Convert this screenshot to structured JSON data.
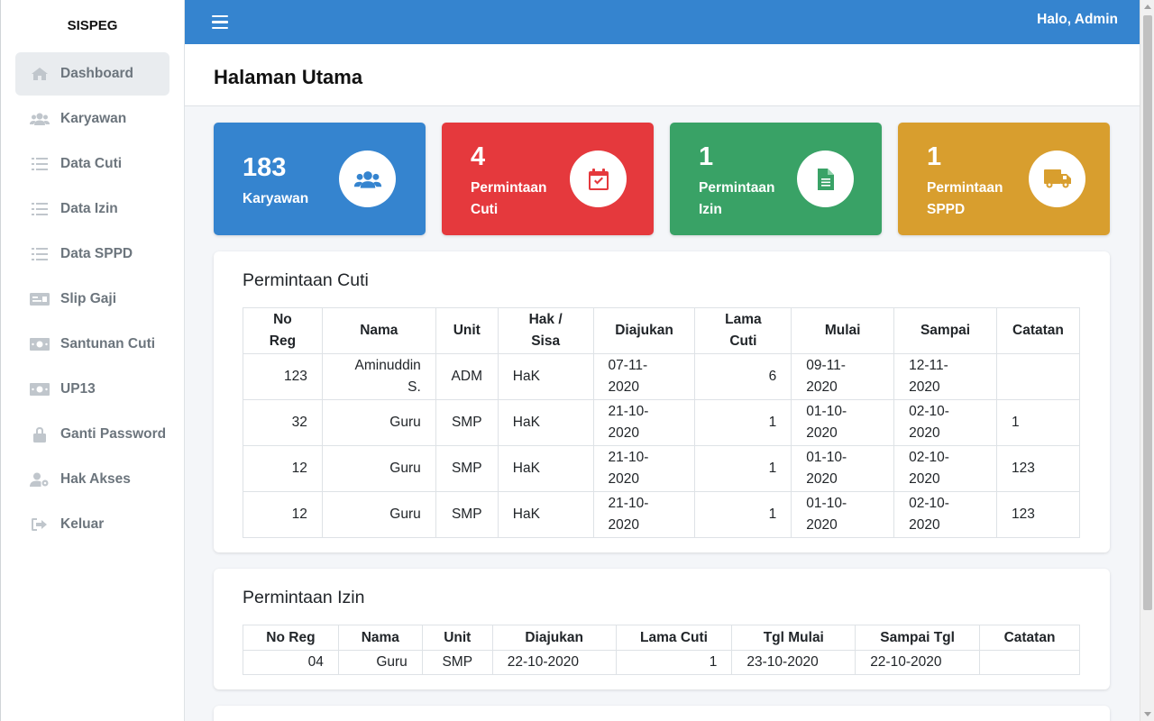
{
  "app": {
    "brand": "SISPEG"
  },
  "sidebar": {
    "items": [
      {
        "label": "Dashboard",
        "icon": "home-icon",
        "active": true
      },
      {
        "label": "Karyawan",
        "icon": "users-icon"
      },
      {
        "label": "Data Cuti",
        "icon": "list-icon"
      },
      {
        "label": "Data Izin",
        "icon": "list-icon"
      },
      {
        "label": "Data SPPD",
        "icon": "list-icon"
      },
      {
        "label": "Slip Gaji",
        "icon": "money-check-icon"
      },
      {
        "label": "Santunan Cuti",
        "icon": "money-bill-icon"
      },
      {
        "label": "UP13",
        "icon": "money-bill-icon"
      },
      {
        "label": "Ganti Password",
        "icon": "lock-icon"
      },
      {
        "label": "Hak Akses",
        "icon": "user-cog-icon"
      },
      {
        "label": "Keluar",
        "icon": "sign-out-icon"
      }
    ]
  },
  "topbar": {
    "greeting": "Halo, Admin"
  },
  "page": {
    "title": "Halaman Utama"
  },
  "stats": [
    {
      "value": "183",
      "label": "Karyawan",
      "color": "#3584cf",
      "icon": "users-icon"
    },
    {
      "value": "4",
      "label_line1": "Permintaan",
      "label_line2": "Cuti",
      "color": "#e5393d",
      "icon": "calendar-check-icon"
    },
    {
      "value": "1",
      "label_line1": "Permintaan",
      "label_line2": "Izin",
      "color": "#39a266",
      "icon": "file-icon"
    },
    {
      "value": "1",
      "label_line1": "Permintaan",
      "label_line2": "SPPD",
      "color": "#d89e2e",
      "icon": "truck-icon"
    }
  ],
  "cuti": {
    "title": "Permintaan Cuti",
    "headers": [
      [
        "No",
        "Reg"
      ],
      [
        "Nama"
      ],
      [
        "Unit"
      ],
      [
        "Hak /",
        "Sisa"
      ],
      [
        "Diajukan"
      ],
      [
        "Lama",
        "Cuti"
      ],
      [
        "Mulai"
      ],
      [
        "Sampai"
      ],
      [
        "Catatan"
      ]
    ],
    "rows": [
      {
        "noreg": "123",
        "nama1": "Aminuddin",
        "nama2": "S.",
        "unit": "ADM",
        "hak": "HaK",
        "diajukan1": "07-11-",
        "diajukan2": "2020",
        "lama": "6",
        "mulai1": "09-11-",
        "mulai2": "2020",
        "sampai1": "12-11-",
        "sampai2": "2020",
        "catatan": ""
      },
      {
        "noreg": "32",
        "nama1": "Guru",
        "nama2": "",
        "unit": "SMP",
        "hak": "HaK",
        "diajukan1": "21-10-",
        "diajukan2": "2020",
        "lama": "1",
        "mulai1": "01-10-",
        "mulai2": "2020",
        "sampai1": "02-10-",
        "sampai2": "2020",
        "catatan": "1"
      },
      {
        "noreg": "12",
        "nama1": "Guru",
        "nama2": "",
        "unit": "SMP",
        "hak": "HaK",
        "diajukan1": "21-10-",
        "diajukan2": "2020",
        "lama": "1",
        "mulai1": "01-10-",
        "mulai2": "2020",
        "sampai1": "02-10-",
        "sampai2": "2020",
        "catatan": "123"
      },
      {
        "noreg": "12",
        "nama1": "Guru",
        "nama2": "",
        "unit": "SMP",
        "hak": "HaK",
        "diajukan1": "21-10-",
        "diajukan2": "2020",
        "lama": "1",
        "mulai1": "01-10-",
        "mulai2": "2020",
        "sampai1": "02-10-",
        "sampai2": "2020",
        "catatan": "123"
      }
    ]
  },
  "izin": {
    "title": "Permintaan Izin",
    "headers": [
      "No Reg",
      "Nama",
      "Unit",
      "Diajukan",
      "Lama Cuti",
      "Tgl Mulai",
      "Sampai Tgl",
      "Catatan"
    ],
    "rows": [
      {
        "noreg": "04",
        "nama": "Guru",
        "unit": "SMP",
        "diajukan": "22-10-2020",
        "lama": "1",
        "mulai": "23-10-2020",
        "sampai": "22-10-2020",
        "catatan": ""
      }
    ]
  }
}
